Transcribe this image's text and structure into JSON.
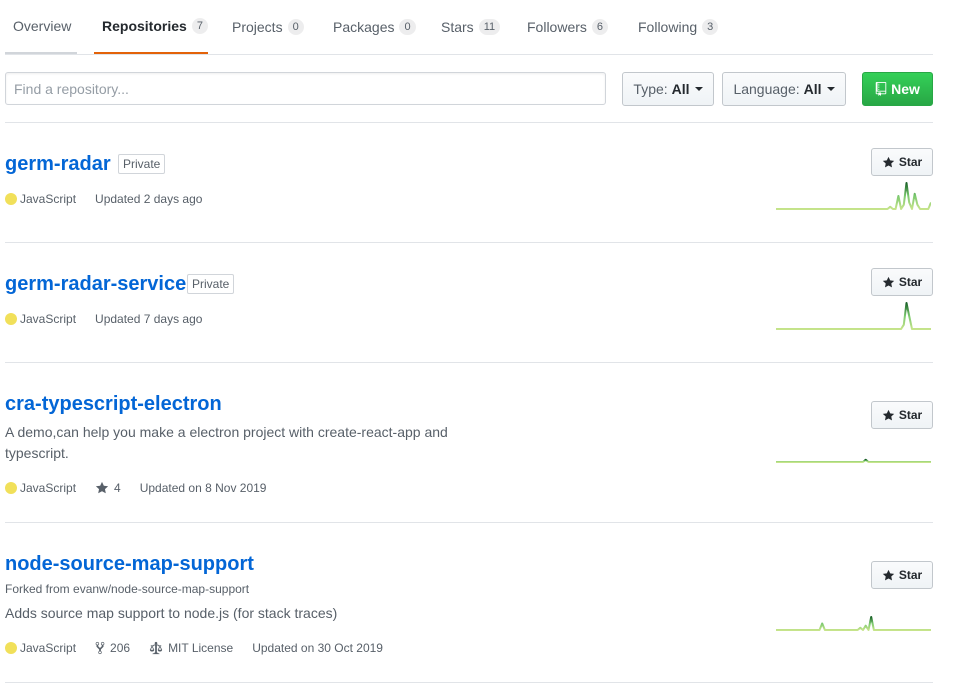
{
  "tabs": [
    {
      "label": "Overview",
      "count": null
    },
    {
      "label": "Repositories",
      "count": "7"
    },
    {
      "label": "Projects",
      "count": "0"
    },
    {
      "label": "Packages",
      "count": "0"
    },
    {
      "label": "Stars",
      "count": "11"
    },
    {
      "label": "Followers",
      "count": "6"
    },
    {
      "label": "Following",
      "count": "3"
    }
  ],
  "active_tab": "Repositories",
  "search": {
    "placeholder": "Find a repository...",
    "value": ""
  },
  "type_filter": {
    "key": "Type:",
    "value": "All"
  },
  "language_filter": {
    "key": "Language:",
    "value": "All"
  },
  "new_label": "New",
  "star_label": "Star",
  "language_color": "#f1e05a",
  "accent_color": "#0366d6",
  "repos": [
    {
      "name": "germ-radar",
      "badge": "Private",
      "language": "JavaScript",
      "updated": "Updated 2 days ago",
      "activity": [
        0,
        0,
        0,
        0,
        0,
        0,
        0,
        0,
        0,
        0,
        0,
        0,
        0,
        0,
        0,
        0,
        0,
        0,
        0,
        0,
        0,
        0,
        0,
        0,
        0,
        0,
        0,
        0,
        0,
        0,
        0,
        0,
        0,
        0,
        0,
        0,
        0,
        0,
        0,
        0,
        0,
        0,
        1,
        0,
        0,
        6,
        0,
        2,
        12,
        3,
        0,
        7,
        2,
        0,
        0,
        0,
        0,
        3
      ]
    },
    {
      "name": "germ-radar-service",
      "badge": "Private",
      "language": "JavaScript",
      "updated": "Updated 7 days ago",
      "activity": [
        0,
        0,
        0,
        0,
        0,
        0,
        0,
        0,
        0,
        0,
        0,
        0,
        0,
        0,
        0,
        0,
        0,
        0,
        0,
        0,
        0,
        0,
        0,
        0,
        0,
        0,
        0,
        0,
        0,
        0,
        0,
        0,
        0,
        0,
        0,
        0,
        0,
        0,
        0,
        0,
        0,
        0,
        0,
        0,
        0,
        0,
        0,
        2,
        12,
        6,
        0,
        0,
        0,
        0,
        0,
        0,
        0,
        0
      ]
    },
    {
      "name": "cra-typescript-electron",
      "description": "A demo,can help you make a electron project with create-react-app and typescript.",
      "language": "JavaScript",
      "stars": "4",
      "updated": "Updated on 8 Nov 2019",
      "activity": [
        0,
        0,
        0,
        0,
        0,
        0,
        0,
        0,
        0,
        0,
        0,
        0,
        0,
        0,
        0,
        0,
        0,
        0,
        0,
        0,
        0,
        0,
        0,
        0,
        0,
        0,
        0,
        0,
        0,
        0,
        0,
        0,
        0,
        1,
        0,
        0,
        0,
        0,
        0,
        0,
        0,
        0,
        0,
        0,
        0,
        0,
        0,
        0,
        0,
        0,
        0,
        0,
        0,
        0,
        0,
        0,
        0,
        0
      ]
    },
    {
      "name": "node-source-map-support",
      "forked_prefix": "Forked from",
      "forked_from": "evanw/node-source-map-support",
      "description": "Adds source map support to node.js (for stack traces)",
      "language": "JavaScript",
      "forks": "206",
      "license": "MIT License",
      "updated": "Updated on 30 Oct 2019",
      "activity": [
        0,
        0,
        0,
        0,
        0,
        0,
        0,
        0,
        0,
        0,
        0,
        0,
        0,
        0,
        0,
        0,
        0,
        3,
        0,
        0,
        0,
        0,
        0,
        0,
        0,
        0,
        0,
        0,
        0,
        0,
        0,
        1,
        0,
        2,
        0,
        6,
        0,
        0,
        0,
        0,
        0,
        0,
        0,
        0,
        0,
        0,
        0,
        0,
        0,
        0,
        0,
        0,
        0,
        0,
        0,
        0,
        0,
        0
      ]
    }
  ]
}
